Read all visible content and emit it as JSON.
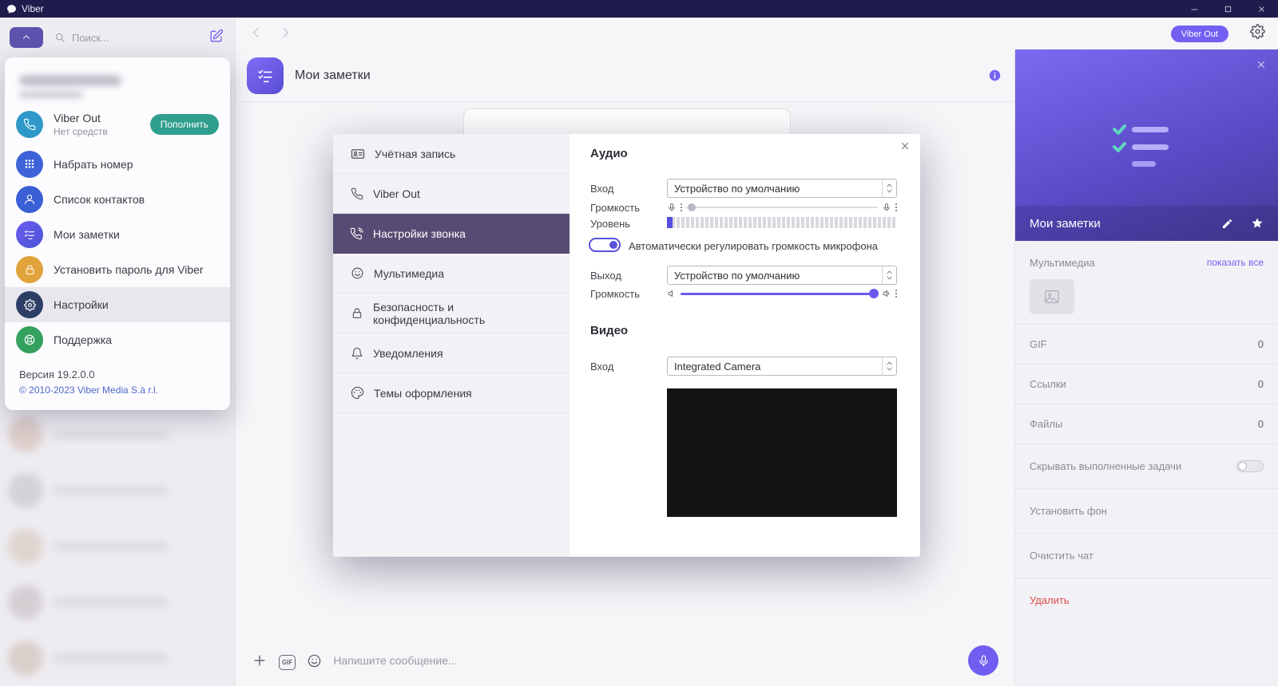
{
  "colors": {
    "brand_purple": "#7360f2",
    "titlebar_bg": "#1f1b4d",
    "active_nav_bg": "#564b73",
    "topup_teal": "#2f9e8e",
    "delete_red": "#de4b48"
  },
  "titlebar": {
    "app_name": "Viber"
  },
  "sidebar": {
    "search_placeholder": "Поиск...",
    "menu": {
      "viber_out_title": "Viber Out",
      "viber_out_subtitle": "Нет средств",
      "topup_button": "Пополнить",
      "items": [
        {
          "label": "Набрать номер"
        },
        {
          "label": "Список контактов"
        },
        {
          "label": "Мои заметки"
        },
        {
          "label": "Установить пароль для Viber"
        },
        {
          "label": "Настройки"
        },
        {
          "label": "Поддержка"
        }
      ],
      "version": "Версия 19.2.0.0",
      "copyright": "© 2010-2023 Viber Media S.à r.l."
    }
  },
  "topbar": {
    "viber_out_badge": "Viber Out"
  },
  "chat": {
    "title": "Мои заметки",
    "message_placeholder": "Напишите сообщение...",
    "gif_label": "GIF"
  },
  "settings": {
    "nav": [
      {
        "label": "Учётная запись"
      },
      {
        "label": "Viber Out"
      },
      {
        "label": "Настройки звонка"
      },
      {
        "label": "Мультимедиа"
      },
      {
        "label": "Безопасность и конфиденциальность"
      },
      {
        "label": "Уведомления"
      },
      {
        "label": "Темы оформления"
      }
    ],
    "audio": {
      "heading": "Аудио",
      "input_label": "Вход",
      "input_device": "Устройство по умолчанию",
      "input_volume_label": "Громкость",
      "level_label": "Уровень",
      "auto_gain": "Автоматически регулировать громкость микрофона",
      "output_label": "Выход",
      "output_device": "Устройство по умолчанию",
      "output_volume_label": "Громкость"
    },
    "video": {
      "heading": "Видео",
      "input_label": "Вход",
      "input_device": "Integrated Camera"
    }
  },
  "info_panel": {
    "title": "Мои заметки",
    "media_label": "Мультимедиа",
    "show_all_link": "показать все",
    "rows": [
      {
        "label": "GIF",
        "count": "0"
      },
      {
        "label": "Ссылки",
        "count": "0"
      },
      {
        "label": "Файлы",
        "count": "0"
      }
    ],
    "hide_done_tasks": "Скрывать выполненные задачи",
    "set_background": "Установить фон",
    "clear_chat": "Очистить чат",
    "delete_chat": "Удалить"
  }
}
